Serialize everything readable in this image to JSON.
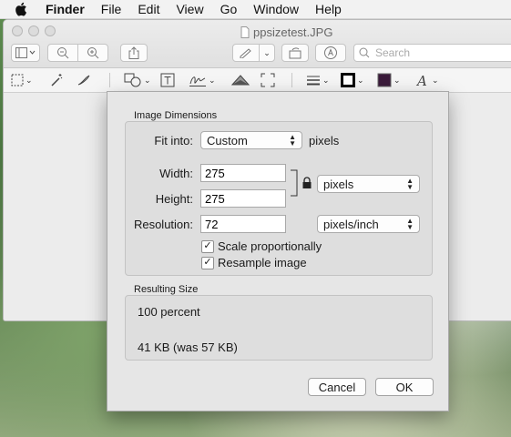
{
  "menubar": {
    "app": "Finder",
    "items": [
      "File",
      "Edit",
      "View",
      "Go",
      "Window",
      "Help"
    ]
  },
  "window": {
    "title": "ppsizetest.JPG",
    "search_placeholder": "Search"
  },
  "dialog": {
    "image_dimensions_label": "Image Dimensions",
    "fit_into_label": "Fit into:",
    "fit_into_value": "Custom",
    "fit_into_unit": "pixels",
    "width_label": "Width:",
    "width_value": "275",
    "height_label": "Height:",
    "height_value": "275",
    "size_unit": "pixels",
    "resolution_label": "Resolution:",
    "resolution_value": "72",
    "resolution_unit": "pixels/inch",
    "scale_label": "Scale proportionally",
    "scale_checked": true,
    "resample_label": "Resample image",
    "resample_checked": true,
    "resulting_size_label": "Resulting Size",
    "result_percent": "100 percent",
    "result_size": "41 KB (was 57 KB)",
    "cancel_label": "Cancel",
    "ok_label": "OK"
  },
  "colors": {
    "fill_color": "#3a1a3a",
    "border_color": "#000000"
  },
  "icons": {
    "toolbar": [
      "sidebar-icon",
      "zoom-out-icon",
      "zoom-in-icon",
      "share-icon",
      "markup-pen-icon",
      "rotate-icon",
      "annotate-icon",
      "search-icon"
    ],
    "markup": [
      "rect-selection-icon",
      "instant-alpha-icon",
      "sketch-icon",
      "shapes-icon",
      "text-icon",
      "sign-icon",
      "adjust-color-icon",
      "adjust-size-icon",
      "line-style-icon",
      "border-color-icon",
      "fill-color-icon",
      "text-style-icon"
    ]
  }
}
